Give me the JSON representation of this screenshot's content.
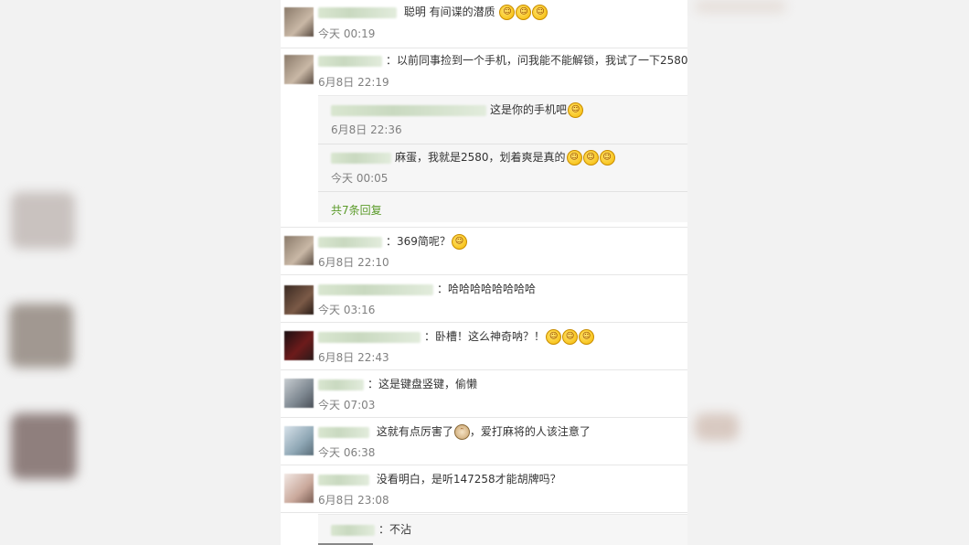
{
  "comments": [
    {
      "text": "聪明 有间谍的潜质",
      "emojis": 3,
      "time": "今天 00:19"
    },
    {
      "text": "以前同事捡到一个手机，问我能不能解锁，我试了一下2580，",
      "time": "6月8日 22:19",
      "replies": [
        {
          "text": "这是你的手机吧",
          "time": "6月8日 22:36"
        },
        {
          "text": "麻蛋，我就是2580，划着爽是真的",
          "time": "今天 00:05"
        }
      ],
      "more_label": "共7条回复"
    },
    {
      "text": "369简呢？",
      "time": "6月8日 22:10"
    },
    {
      "text": "哈哈哈哈哈哈哈哈",
      "time": "今天 03:16"
    },
    {
      "text": "卧槽！这么神奇呐？！",
      "time": "6月8日 22:43"
    },
    {
      "text": "这是键盘竖键，偷懒",
      "time": "今天 07:03"
    },
    {
      "text": "这就有点厉害了",
      "text_after": "，爱打麻将的人该注意了",
      "time": "今天 06:38"
    },
    {
      "text": "没看明白，是听147258才能胡牌吗？",
      "time": "6月8日 23:08"
    },
    {
      "text": "不沾",
      "time": ""
    }
  ],
  "colors": {
    "link": "#5b9b2a",
    "time": "#808080",
    "text": "#333333"
  }
}
